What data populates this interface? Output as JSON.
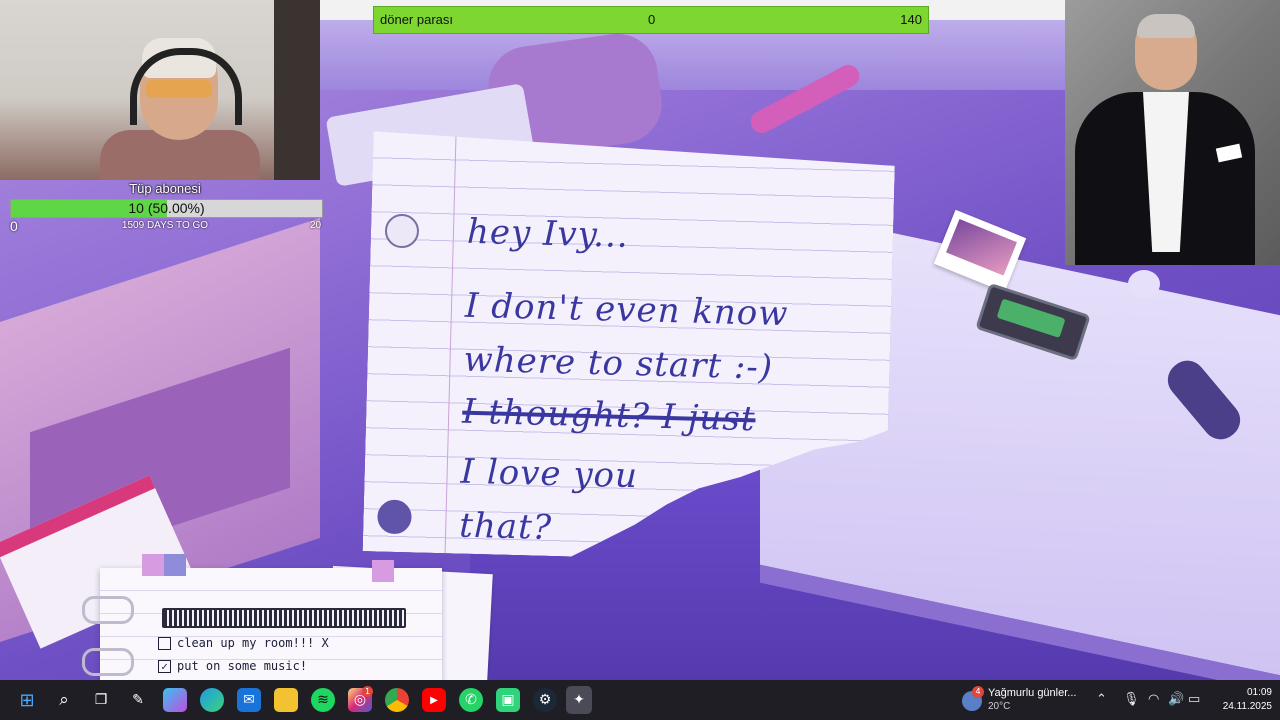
{
  "stream_overlay": {
    "money_bar": {
      "label": "döner parası",
      "current": "0",
      "goal": "140",
      "progress": 0
    },
    "sub_goal": {
      "title": "Tüp abonesi",
      "bar_text": "10 (50.00%)",
      "progress": 0.5,
      "min": "0",
      "days_to_go": "1509 DAYS TO GO",
      "max": "20"
    }
  },
  "game": {
    "letter_lines": [
      {
        "text": "hey Ivy...",
        "struck": false
      },
      {
        "text": "I don't even know",
        "struck": false
      },
      {
        "text": "where to start :-)",
        "struck": false
      },
      {
        "text": "I thought? I just",
        "struck": true
      },
      {
        "text": "I love you",
        "struck": false
      },
      {
        "text": "that?",
        "struck": false
      }
    ],
    "todo": {
      "items": [
        {
          "text": "clean up my room!!! X",
          "checked": false
        },
        {
          "text": "put on some music!",
          "checked": true
        }
      ]
    }
  },
  "taskbar": {
    "icons": [
      "windows-start-icon",
      "search-icon",
      "task-view-icon",
      "app-icon",
      "copilot-icon",
      "edge-icon",
      "mail-icon",
      "file-explorer-icon",
      "spotify-icon",
      "instagram-icon",
      "chrome-icon",
      "youtube-icon",
      "whatsapp-icon",
      "app-store-icon",
      "steam-icon",
      "game-icon"
    ],
    "instagram_badge": "1",
    "weather": {
      "badge": "4",
      "text": "Yağmurlu günler...",
      "temp": "20°C"
    },
    "clock": {
      "time": "01:09",
      "date": "24.11.2025"
    }
  },
  "colors": {
    "money_green": "#7ed631",
    "sub_green": "#5fd646",
    "taskbar": "#1e1e24",
    "ink": "#3a37a0"
  }
}
